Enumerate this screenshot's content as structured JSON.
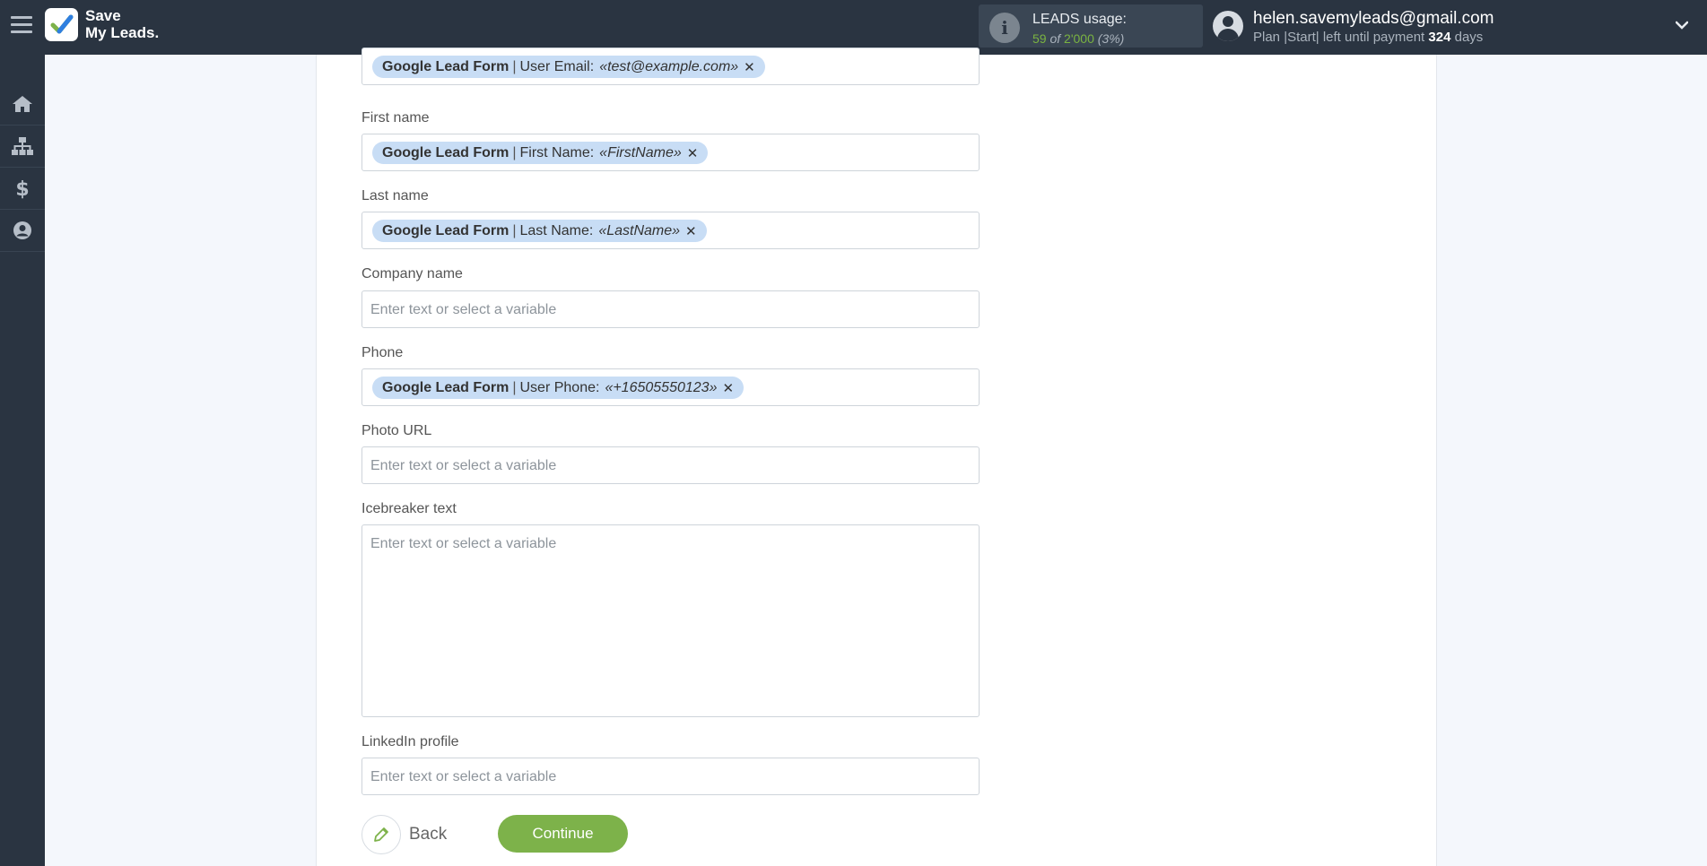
{
  "header": {
    "logo_line1": "Save",
    "logo_line2": "My Leads.",
    "usage_label": "LEADS usage:",
    "usage_used": "59",
    "usage_of": "of",
    "usage_limit": "2'000",
    "usage_percent": "(3%)",
    "user_email": "helen.savemyleads@gmail.com",
    "plan_text": "Plan |Start| left until payment",
    "days_count": "324",
    "days_label": "days"
  },
  "sidebar": {
    "items": [
      {
        "icon": "home-icon"
      },
      {
        "icon": "sitemap-icon"
      },
      {
        "icon": "dollar-icon"
      },
      {
        "icon": "user-circle-icon"
      }
    ]
  },
  "form": {
    "email": {
      "tag_source": "Google Lead Form",
      "tag_sep": "|",
      "tag_field": "User Email:",
      "tag_value": "«test@example.com»"
    },
    "first_name": {
      "label": "First name",
      "tag_source": "Google Lead Form",
      "tag_sep": "|",
      "tag_field": "First Name:",
      "tag_value": "«FirstName»"
    },
    "last_name": {
      "label": "Last name",
      "tag_source": "Google Lead Form",
      "tag_sep": "|",
      "tag_field": "Last Name:",
      "tag_value": "«LastName»"
    },
    "company_name": {
      "label": "Company name",
      "placeholder": "Enter text or select a variable"
    },
    "phone": {
      "label": "Phone",
      "tag_source": "Google Lead Form",
      "tag_sep": "|",
      "tag_field": "User Phone:",
      "tag_value": "«+16505550123»"
    },
    "photo_url": {
      "label": "Photo URL",
      "placeholder": "Enter text or select a variable"
    },
    "icebreaker": {
      "label": "Icebreaker text",
      "placeholder": "Enter text or select a variable"
    },
    "linkedin": {
      "label": "LinkedIn profile",
      "placeholder": "Enter text or select a variable"
    },
    "back_label": "Back",
    "continue_label": "Continue"
  },
  "colors": {
    "topbar": "#2a3441",
    "accent_green": "#7db24a",
    "tag_bg": "#c8ddf5"
  }
}
